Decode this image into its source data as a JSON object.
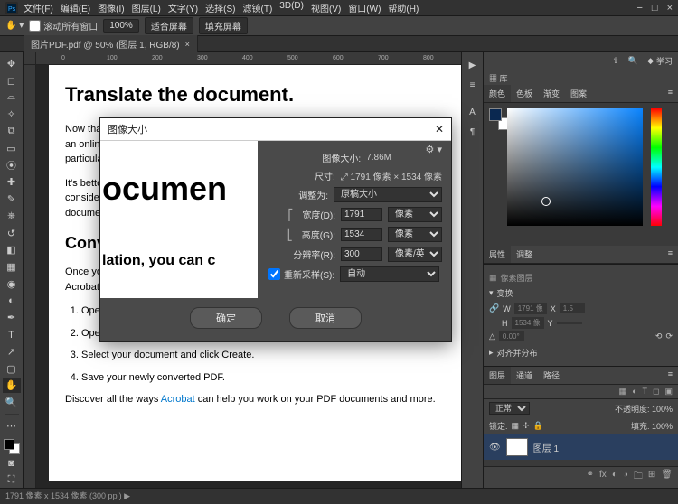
{
  "menubar": [
    "文件(F)",
    "编辑(E)",
    "图像(I)",
    "图层(L)",
    "文字(Y)",
    "选择(S)",
    "滤镜(T)",
    "3D(D)",
    "视图(V)",
    "窗口(W)",
    "帮助(H)"
  ],
  "winctl": {
    "min": "−",
    "max": "□",
    "close": "×"
  },
  "optionbar": {
    "scroll_all": "滚动所有窗口",
    "zoom": "100%",
    "fit": "适合屏幕",
    "fill": "填充屏幕"
  },
  "tab": {
    "title": "图片PDF.pdf @ 50% (图层 1, RGB/8)",
    "close": "×"
  },
  "ruler_marks": [
    "0",
    "100",
    "200",
    "300",
    "400",
    "500",
    "600",
    "700",
    "800"
  ],
  "doc": {
    "h1": "Translate the document.",
    "p1a": "Now that y",
    "p1b": "an online t",
    "p1c": "particularl",
    "p2a": "It's better t",
    "p2b": "consider h",
    "p2c": "document",
    "h2a": "Conv",
    "h2b": "lation, you can c",
    "p3": "Once you'",
    "p3b": "Acrobat.",
    "li1": "Open Acrobat.",
    "li2": "Open the Tools menu and select Create PDF.",
    "li3": "Select your document and click Create.",
    "li4": "Save your newly converted PDF.",
    "p4a": "Discover all the ways ",
    "p4link": "Acrobat",
    "p4b": " can help you work on your PDF documents and more."
  },
  "dialog": {
    "title": "图像大小",
    "size_label": "图像大小:",
    "size_val": "7.86M",
    "dim_label": "尺寸:",
    "dim_val": "1791 像素 × 1534 像素",
    "fit_label": "调整为:",
    "fit_val": "原稿大小",
    "w_label": "宽度(D):",
    "w_val": "1791",
    "w_unit": "像素",
    "h_label": "高度(G):",
    "h_val": "1534",
    "h_unit": "像素",
    "res_label": "分辨率(R):",
    "res_val": "300",
    "res_unit": "像素/英寸",
    "resample": "重新采样(S):",
    "resample_val": "自动",
    "ok": "确定",
    "cancel": "取消",
    "preview_big": "ocumen",
    "preview_sub": "lation, you can c"
  },
  "right": {
    "study": "学习",
    "library": "库",
    "color_tabs": [
      "颜色",
      "色板",
      "渐变",
      "图案"
    ],
    "prop_tabs": [
      "属性",
      "调整"
    ],
    "prop_pixel": "像素图层",
    "transform": "变换",
    "w": "W",
    "h": "H",
    "ww": "1791 像",
    "hh": "1534 像",
    "x": "X",
    "y": "Y",
    "xx": "1.5",
    "yy": "",
    "angle": "0.00°",
    "align": "对齐并分布",
    "layer_tabs": [
      "图层",
      "通道",
      "路径"
    ],
    "blend": "正常",
    "opacity_lbl": "不透明度:",
    "opacity": "100%",
    "lock_lbl": "锁定:",
    "fill_lbl": "填充:",
    "fill": "100%",
    "layer1": "图层 1"
  },
  "status": "1791 像素 x 1534 像素 (300 ppi)  ▶"
}
